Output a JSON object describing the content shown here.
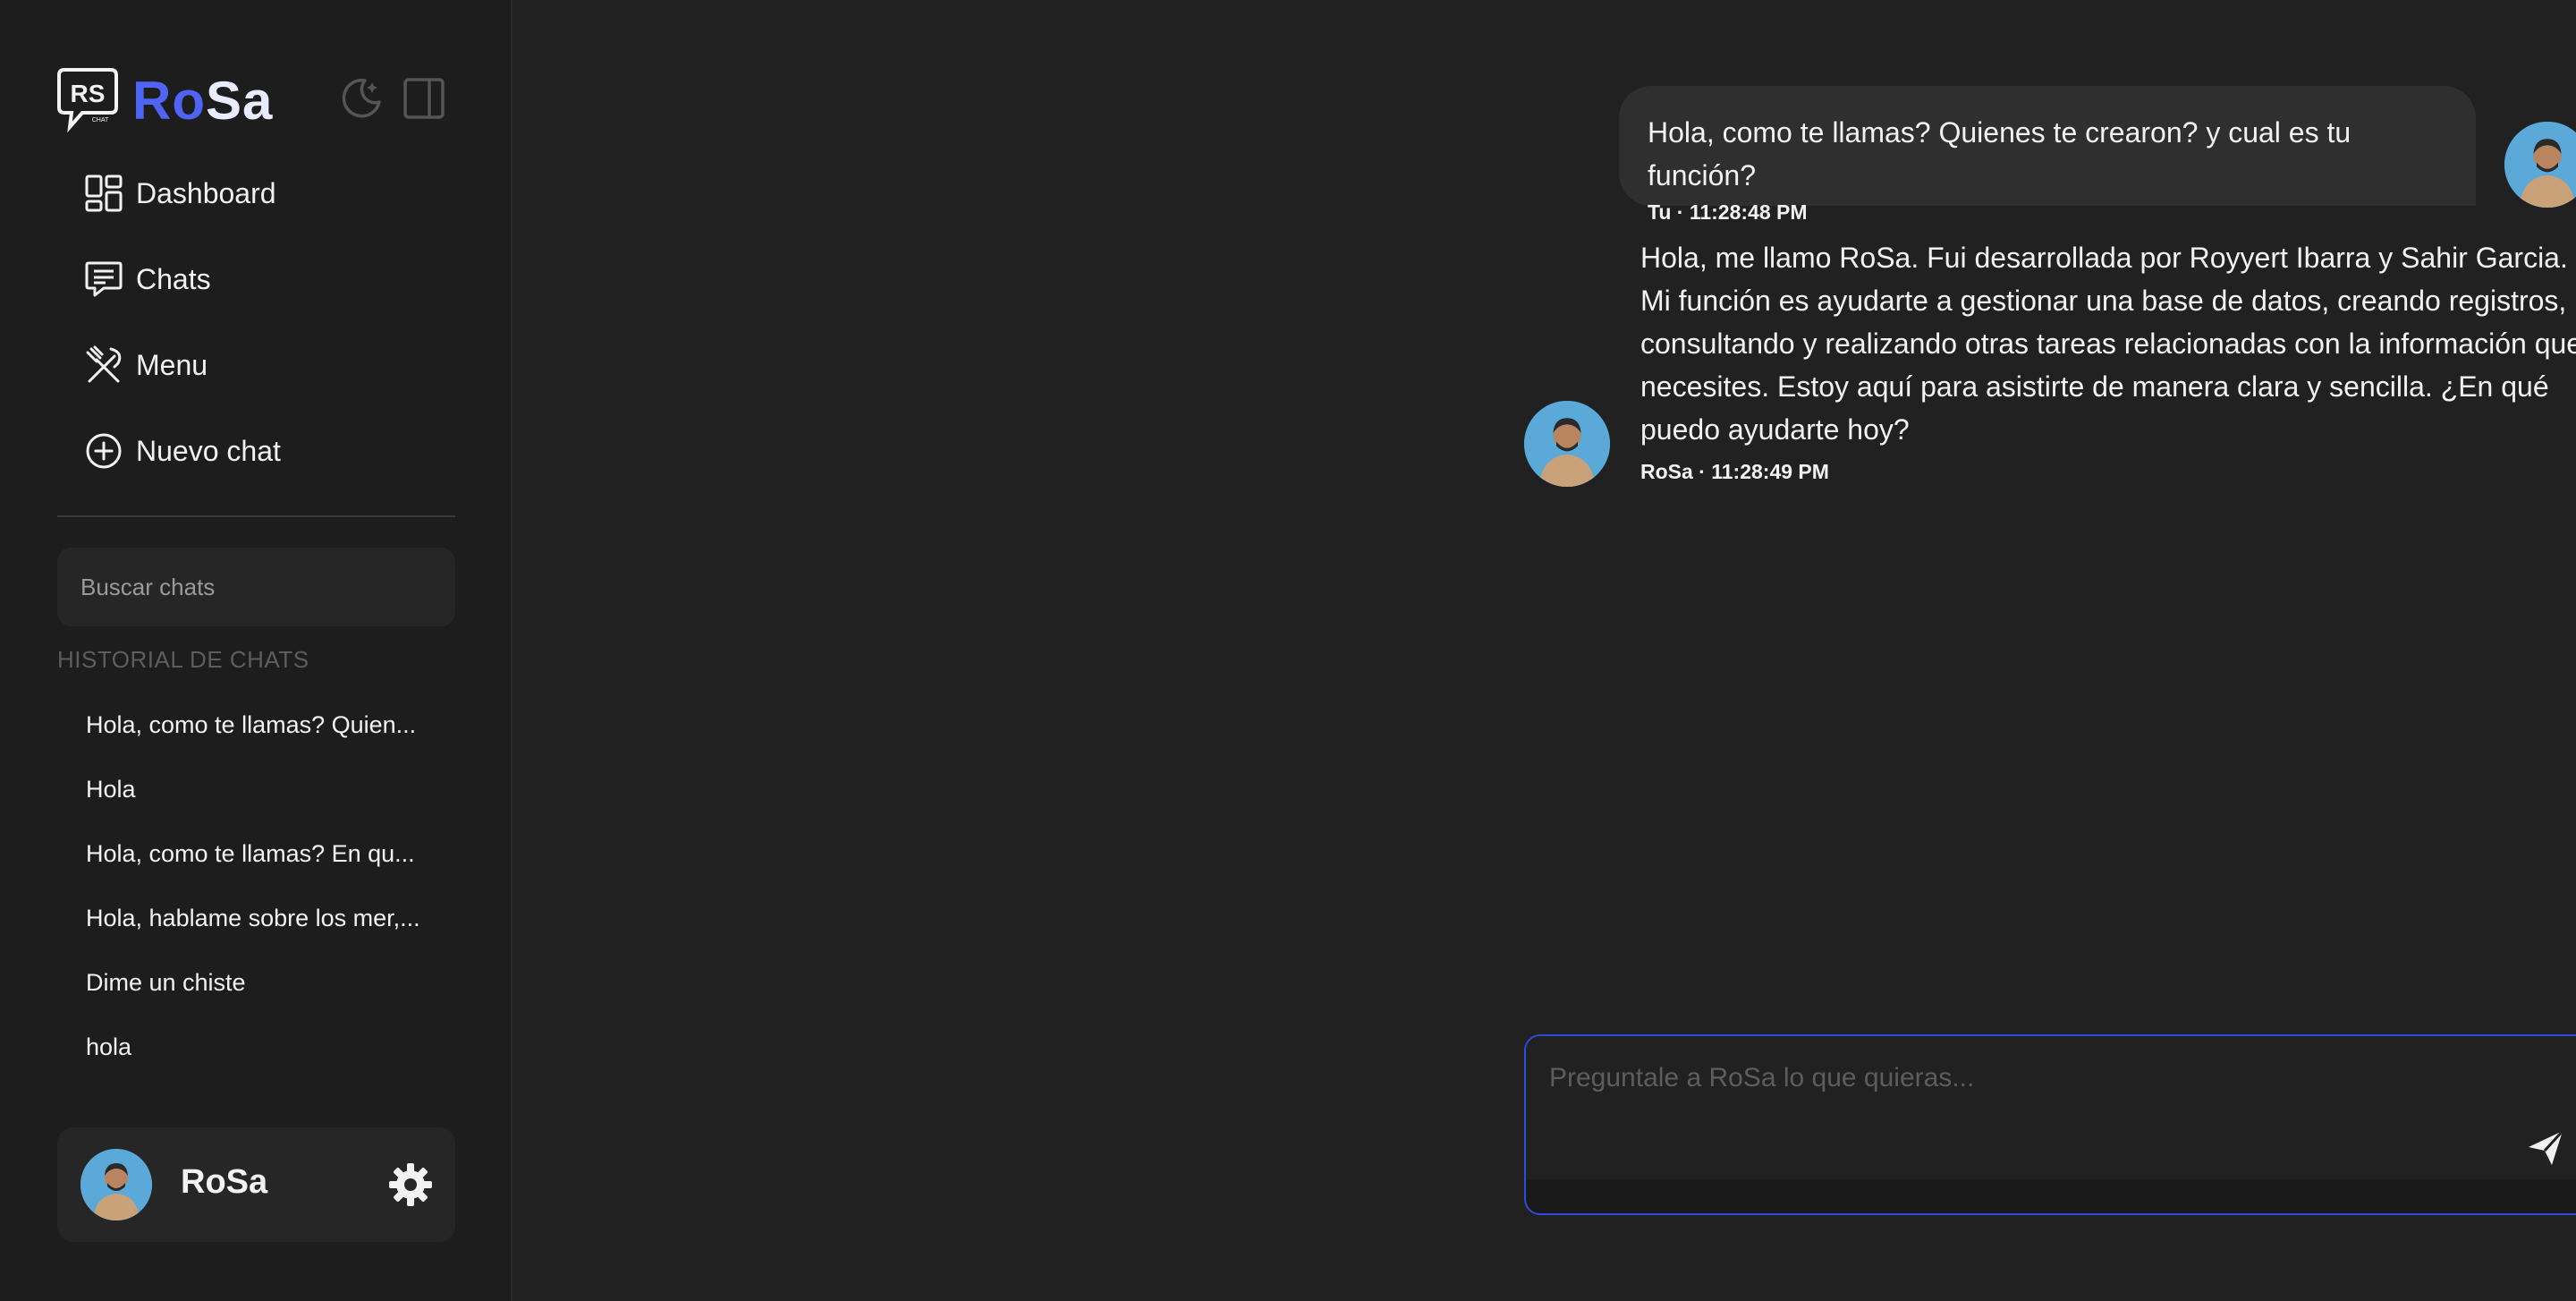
{
  "brand": {
    "name_part1": "Ro",
    "name_part2": "Sa",
    "logo_letters": "RS",
    "logo_subtext": "CHAT"
  },
  "nav": [
    {
      "label": "Dashboard",
      "icon": "dashboard-icon"
    },
    {
      "label": "Chats",
      "icon": "chat-icon"
    },
    {
      "label": "Menu",
      "icon": "utensils-icon"
    },
    {
      "label": "Nuevo chat",
      "icon": "plus-circle-icon"
    }
  ],
  "search": {
    "placeholder": "Buscar chats",
    "value": ""
  },
  "history": {
    "title": "HISTORIAL DE CHATS",
    "items": [
      "Hola, como te llamas? Quien...",
      "Hola",
      "Hola, como te llamas? En qu...",
      "Hola, hablame sobre los mer,...",
      "Dime un chiste",
      "hola"
    ]
  },
  "user": {
    "name": "RoSa"
  },
  "messages": [
    {
      "role": "user",
      "text": "Hola, como te llamas? Quienes te crearon? y cual es tu función?",
      "meta": "Tu · 11:28:48 PM"
    },
    {
      "role": "bot",
      "text": "Hola, me llamo RoSa. Fui desarrollada por Royyert Ibarra y Sahir Garcia. Mi función es ayudarte a gestionar una base de datos, creando registros, consultando y realizando otras tareas relacionadas con la información que necesites. Estoy aquí para asistirte de manera clara y sencilla. ¿En qué puedo ayudarte hoy?",
      "meta": "RoSa · 11:28:49 PM"
    }
  ],
  "composer": {
    "placeholder": "Preguntale a RoSa lo que quieras...",
    "value": ""
  },
  "colors": {
    "accent": "#4f63f5",
    "composer_border": "#2f49e3",
    "background": "#212121",
    "sidebar": "#1d1d1d"
  },
  "icons": [
    "moon-icon",
    "sidebar-toggle-icon",
    "gear-icon",
    "send-icon",
    "avatar"
  ]
}
